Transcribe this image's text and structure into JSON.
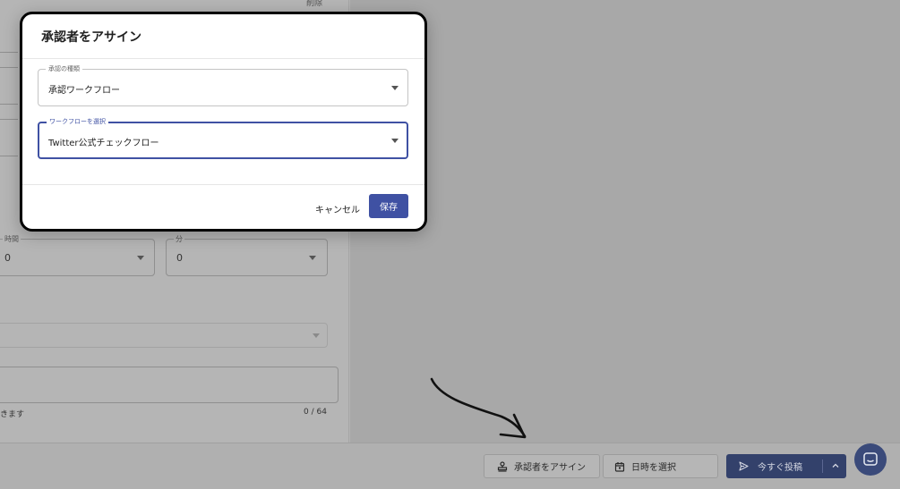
{
  "background": {
    "top_right_label": "削除",
    "hour_field": {
      "legend": "時間",
      "value": "0"
    },
    "minute_field": {
      "legend": "分",
      "value": "0"
    },
    "char_hint": "きます",
    "char_counter": "0 / 64"
  },
  "footer": {
    "assign_approver_label": "承認者をアサイン",
    "select_datetime_label": "日時を選択",
    "post_now_label": "今すぐ投稿"
  },
  "modal": {
    "title": "承認者をアサイン",
    "approval_type": {
      "legend": "承認の種類",
      "value": "承認ワークフロー"
    },
    "workflow_select": {
      "legend": "ワークフローを選択",
      "value": "Twitter公式チェックフロー"
    },
    "cancel_label": "キャンセル",
    "save_label": "保存"
  },
  "colors": {
    "accent": "#3f51a3",
    "post_button": "#33416b",
    "overlay": "#b3b3b3"
  },
  "icons": [
    "stamp-icon",
    "calendar-icon",
    "send-icon",
    "chevron-up-icon",
    "chat-icon",
    "dropdown-caret-icon"
  ]
}
